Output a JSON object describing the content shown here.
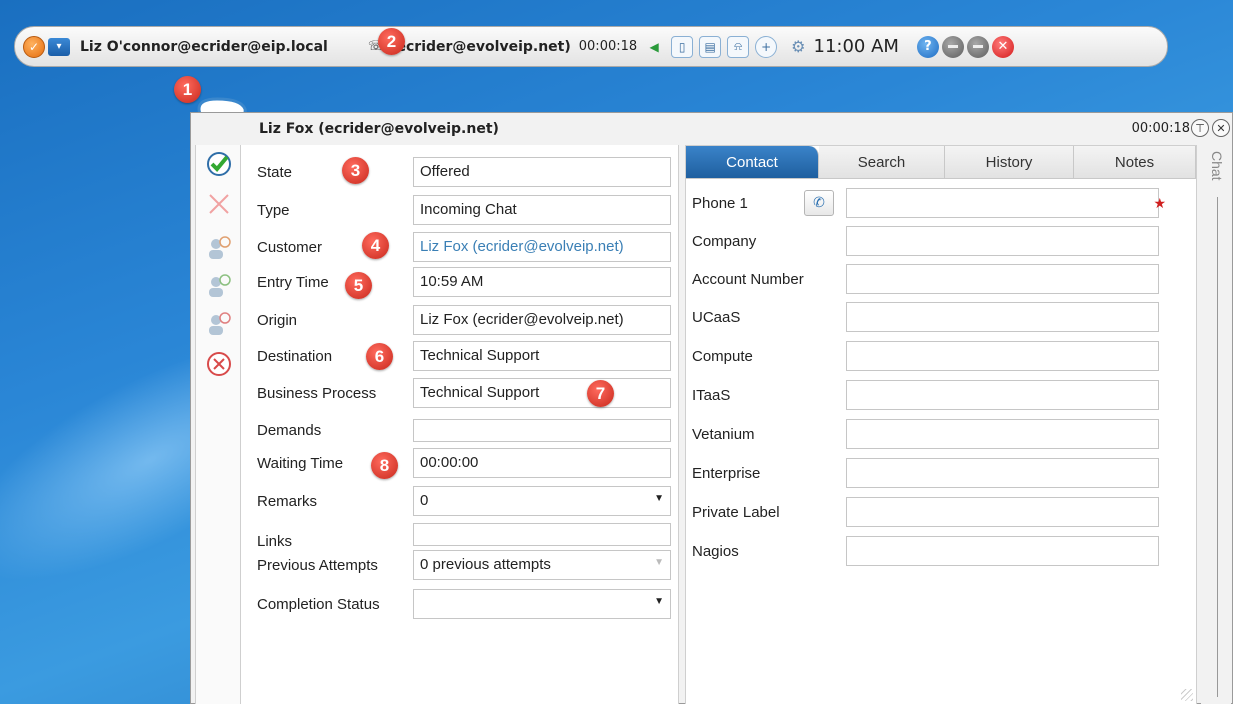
{
  "toolbar": {
    "user": "Liz O'connor@ecrider@eip.local",
    "active_contact": "(ecrider@evolveip.net)",
    "timer": "00:00:18",
    "clock": "11:00 AM",
    "help_label": "?",
    "close_label": "✕",
    "colors": {
      "accent": "#2a86d6",
      "close": "#d31a1a"
    }
  },
  "callouts": [
    "1",
    "2",
    "3",
    "4",
    "5",
    "6",
    "7",
    "8"
  ],
  "chat": {
    "title": "Liz Fox (ecrider@evolveip.net)",
    "timer": "00:00:18",
    "side_label": "Chat"
  },
  "fields": [
    {
      "label": "State",
      "value": "Offered"
    },
    {
      "label": "Type",
      "value": "Incoming Chat"
    },
    {
      "label": "Customer",
      "value": "Liz Fox (ecrider@evolveip.net)"
    },
    {
      "label": "Entry Time",
      "value": "10:59 AM"
    },
    {
      "label": "Origin",
      "value": "Liz Fox (ecrider@evolveip.net)"
    },
    {
      "label": "Destination",
      "value": "Technical Support"
    },
    {
      "label": "Business Process",
      "value": "Technical Support"
    },
    {
      "label": "Demands",
      "value": ""
    },
    {
      "label": "Waiting Time",
      "value": "00:00:00"
    },
    {
      "label": "Remarks",
      "value": "0"
    },
    {
      "label": "Links",
      "value": ""
    },
    {
      "label": "Previous Attempts",
      "value": "0 previous attempts"
    },
    {
      "label": "Completion Status",
      "value": ""
    }
  ],
  "tabs": [
    "Contact",
    "Search",
    "History",
    "Notes"
  ],
  "contact_fields": [
    "Phone 1",
    "Company",
    "Account Number",
    "UCaaS",
    "Compute",
    "ITaaS",
    "Vetanium",
    "Enterprise",
    "Private Label",
    "Nagios"
  ],
  "required_marker": "★"
}
